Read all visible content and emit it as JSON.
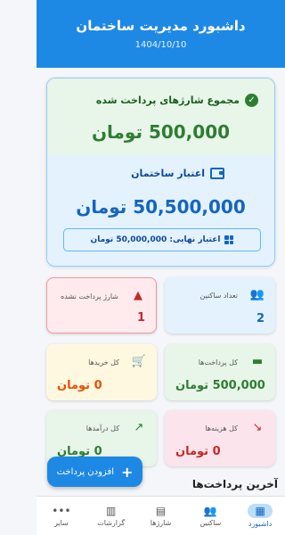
{
  "header": {
    "title": "داشبورد مدیریت ساختمان",
    "date": "1404/10/10"
  },
  "summary": {
    "paid_label": "مجموع شارژهای پرداخت شده",
    "paid_amount": "500,000 تومان",
    "credit_label": "اعتبار ساختمان",
    "credit_amount": "50,500,000 تومان",
    "final_credit": "اعتبار نهایی: 50,000,000 تومان"
  },
  "cards": [
    {
      "label": "تعداد ساکنین",
      "value": "2",
      "icon": "people-icon"
    },
    {
      "label": "شارژ پرداخت نشده",
      "value": "1",
      "icon": "warning-icon"
    },
    {
      "label": "کل پرداخت‌ها",
      "value": "500,000 تومان",
      "icon": "card-icon"
    },
    {
      "label": "کل خریدها",
      "value": "0 تومان",
      "icon": "cart-icon"
    },
    {
      "label": "کل هزینه‌ها",
      "value": "0 تومان",
      "icon": "trend-down-icon"
    },
    {
      "label": "کل درآمدها",
      "value": "0 تومان",
      "icon": "trend-up-icon"
    }
  ],
  "fab_label": "افزودن پرداخت",
  "recent_title": "آخرین پرداخت‌ها",
  "nav": [
    {
      "label": "داشبورد",
      "icon": "dashboard-icon"
    },
    {
      "label": "ساکنین",
      "icon": "people-icon"
    },
    {
      "label": "شارژها",
      "icon": "receipt-icon"
    },
    {
      "label": "گزارشات",
      "icon": "report-icon"
    },
    {
      "label": "سایر",
      "icon": "more-icon"
    }
  ],
  "colors": {
    "primary": "#1e88e5",
    "green": "#2e7d32",
    "red": "#c62828",
    "orange": "#e65100"
  }
}
